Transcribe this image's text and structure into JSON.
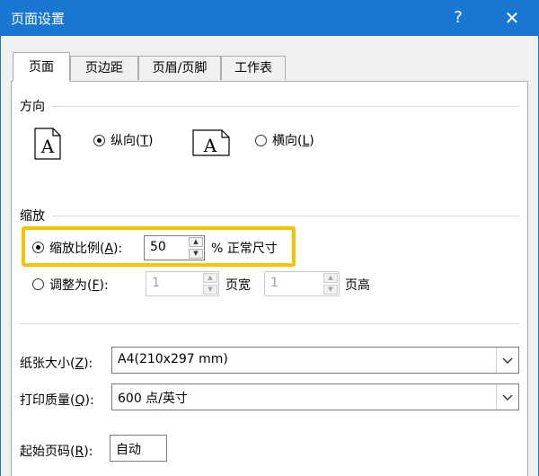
{
  "window": {
    "title": "页面设置",
    "help": "?",
    "close": "✕"
  },
  "tabs": [
    {
      "label": "页面",
      "active": true
    },
    {
      "label": "页边距",
      "active": false
    },
    {
      "label": "页眉/页脚",
      "active": false
    },
    {
      "label": "工作表",
      "active": false
    }
  ],
  "orientation": {
    "section": "方向",
    "icon_glyph": "A",
    "portrait": {
      "label": "纵向",
      "key": "T",
      "checked": true
    },
    "landscape": {
      "label": "横向",
      "key": "L",
      "checked": false
    }
  },
  "scaling": {
    "section": "缩放",
    "adjust": {
      "label": "缩放比例",
      "key": "A",
      "value": "50",
      "suffix": "% 正常尺寸",
      "checked": true
    },
    "fit": {
      "label": "调整为",
      "key": "F",
      "wide_value": "1",
      "wide_label": "页宽",
      "tall_value": "1",
      "tall_label": "页高",
      "checked": false
    }
  },
  "paper_size": {
    "label": "纸张大小",
    "key": "Z",
    "value": "A4(210x297 mm)"
  },
  "print_quality": {
    "label": "打印质量",
    "key": "Q",
    "value": "600 点/英寸"
  },
  "first_page": {
    "label": "起始页码",
    "key": "R",
    "value": "自动"
  },
  "colors": {
    "titlebar": "#1977d2",
    "highlight": "#f5c400"
  }
}
